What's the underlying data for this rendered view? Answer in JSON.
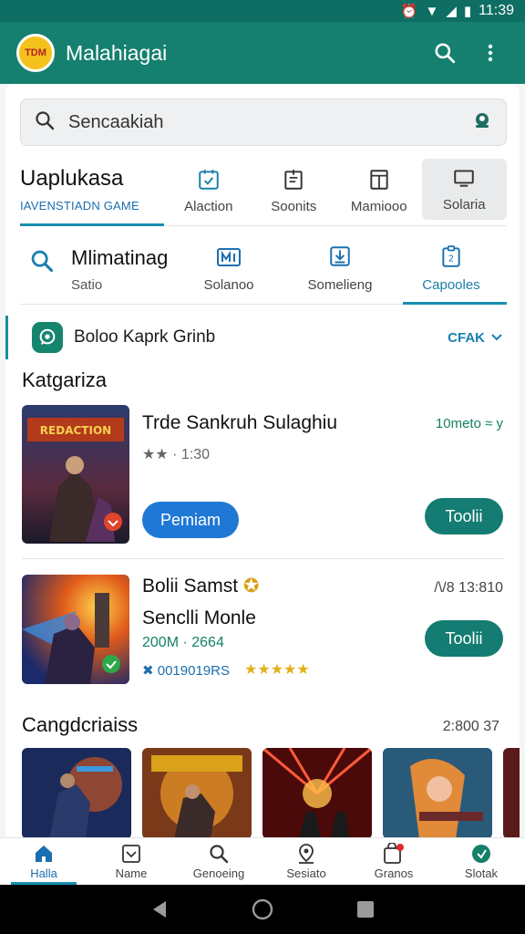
{
  "status_bar": {
    "time": "11:39"
  },
  "app_bar": {
    "logo_text": "TDM",
    "title": "Malahiagai"
  },
  "search": {
    "placeholder": "Sencaakiah"
  },
  "category_tabs": {
    "main_title": "Uaplukasa",
    "main_subtitle": "IAVENSTIADN GAME",
    "tabs": [
      {
        "label": "Alaction",
        "icon": "gamepad-icon"
      },
      {
        "label": "Soonits",
        "icon": "notepad-icon"
      },
      {
        "label": "Mamiooo",
        "icon": "document-icon"
      },
      {
        "label": "Solaria",
        "icon": "monitor-icon"
      }
    ]
  },
  "sub_tabs": {
    "first_title": "Mlimatinag",
    "first_subtitle": "Satio",
    "tabs": [
      {
        "label": "Solanoo",
        "icon": "grid-icon"
      },
      {
        "label": "Somelieng",
        "icon": "download-icon"
      },
      {
        "label": "Capooles",
        "icon": "clipboard-icon"
      }
    ]
  },
  "featured": {
    "label": "Boloo Kaprk Grinb",
    "action": "CFAK"
  },
  "sections": {
    "categories_title": "Katgariza",
    "second_title": "Cangdcriaiss",
    "second_meta": "2:800 37"
  },
  "games": [
    {
      "title": "Trde Sankruh Sulaghiu",
      "rating_text": "★★ · 1:30",
      "size": "10meto ≈ y",
      "primary_button": "Pemiam",
      "install_button": "Toolii",
      "thumb_title": "REDACTION"
    },
    {
      "title": "Bolii Samst",
      "title2": "Senclli Monle",
      "meta": "200M · 2664",
      "code": "✖ 0019019RS",
      "stars": "★★★★★",
      "right_meta": "/\\/8 13:810",
      "install_button": "Toolii"
    }
  ],
  "bottom_nav": [
    {
      "label": "Halla",
      "icon": "home-icon"
    },
    {
      "label": "Name",
      "icon": "checkbox-icon"
    },
    {
      "label": "Genoeing",
      "icon": "search-icon"
    },
    {
      "label": "Sesiato",
      "icon": "location-icon"
    },
    {
      "label": "Granos",
      "icon": "bag-icon"
    },
    {
      "label": "Slotak",
      "icon": "compass-icon"
    }
  ],
  "colors": {
    "primary": "#15806f",
    "accent": "#1a8fb0",
    "button_blue": "#1f78d6",
    "button_teal": "#147c72"
  }
}
